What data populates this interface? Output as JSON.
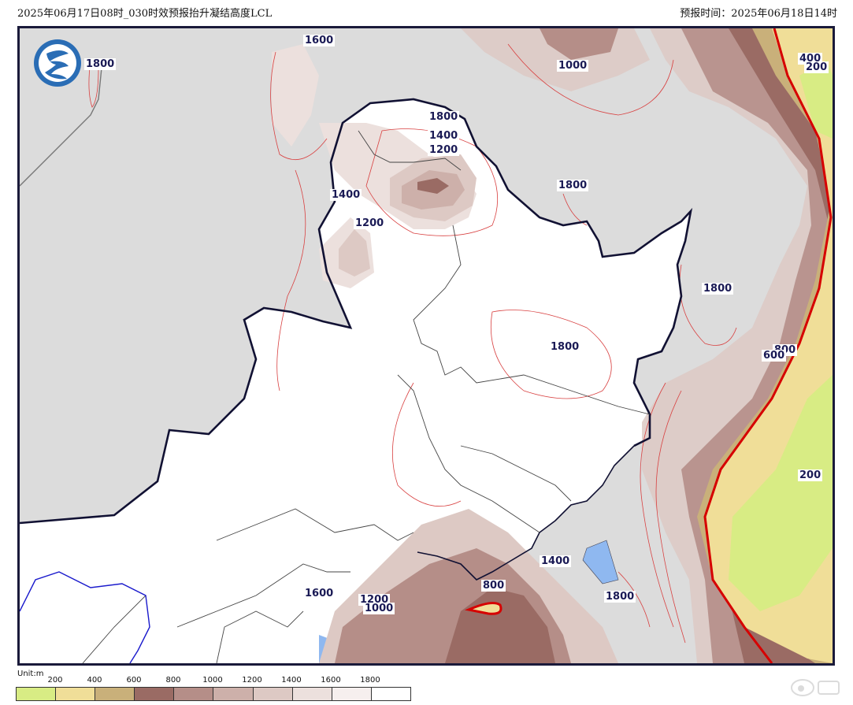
{
  "header": {
    "title": "2025年06月17日08时_030时效预报抬升凝结高度LCL",
    "forecast_time": "预报时间：2025年06月18日14时"
  },
  "map": {
    "contour_labels": [
      "1600",
      "1800",
      "1000",
      "1800",
      "1400",
      "1200",
      "1400",
      "1200",
      "1800",
      "400",
      "200",
      "1800",
      "1800",
      "800",
      "600",
      "200",
      "1400",
      "800",
      "1800",
      "1600",
      "1200",
      "1000"
    ],
    "land_color": "#ffffff",
    "outside_color": "#dcdcdc",
    "sea_color": "#8fb8f0"
  },
  "legend": {
    "unit": "Unit:m",
    "ticks": [
      "200",
      "400",
      "600",
      "800",
      "1000",
      "1200",
      "1400",
      "1600",
      "1800"
    ],
    "colors": [
      "#d8ec84",
      "#f0de98",
      "#c9b07a",
      "#9a6b64",
      "#b58e88",
      "#cdb0aa",
      "#ddc9c4",
      "#ece0dd",
      "#f6efee",
      "#ffffff"
    ]
  },
  "icons": {
    "logo": "weather-agency-logo",
    "watermark": "weibo-watermark"
  }
}
